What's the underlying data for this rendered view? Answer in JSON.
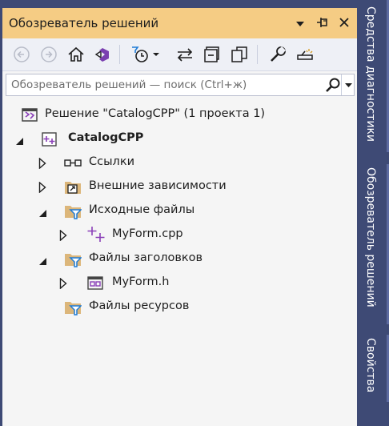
{
  "title_bar": {
    "title": "Обозреватель решений",
    "dropdown_glyph": "▾",
    "pin_glyph": "⊣",
    "close_glyph": "✕"
  },
  "toolbar": {
    "icons": [
      "back-icon",
      "forward-icon",
      "home-icon",
      "switch-views-icon",
      "pending-changes-filter-icon",
      "sync-active-document-icon",
      "collapse-all-icon",
      "show-all-files-icon",
      "properties-icon",
      "preview-icon"
    ]
  },
  "search": {
    "placeholder": "Обозреватель решений — поиск (Ctrl+ж)"
  },
  "tree": {
    "solution": "Решение \"CatalogCPP\"  (1 проекта 1)",
    "project": "CatalogCPP",
    "references": "Ссылки",
    "external_deps": "Внешние зависимости",
    "source_files": "Исходные файлы",
    "source_file_1": "MyForm.cpp",
    "header_files": "Файлы заголовков",
    "header_file_1": "MyForm.h",
    "resource_files": "Файлы ресурсов"
  },
  "side_tabs": {
    "diagnostics": "Средства диагностики",
    "solution_explorer": "Обозреватель решений",
    "properties": "Свойства"
  },
  "colors": {
    "title_bar": "#f5cc84",
    "side_strip": "#3e4a75",
    "folder": "#dcb67a",
    "filter": "#1e7bd6",
    "cpp_purple": "#8a3fb8"
  }
}
